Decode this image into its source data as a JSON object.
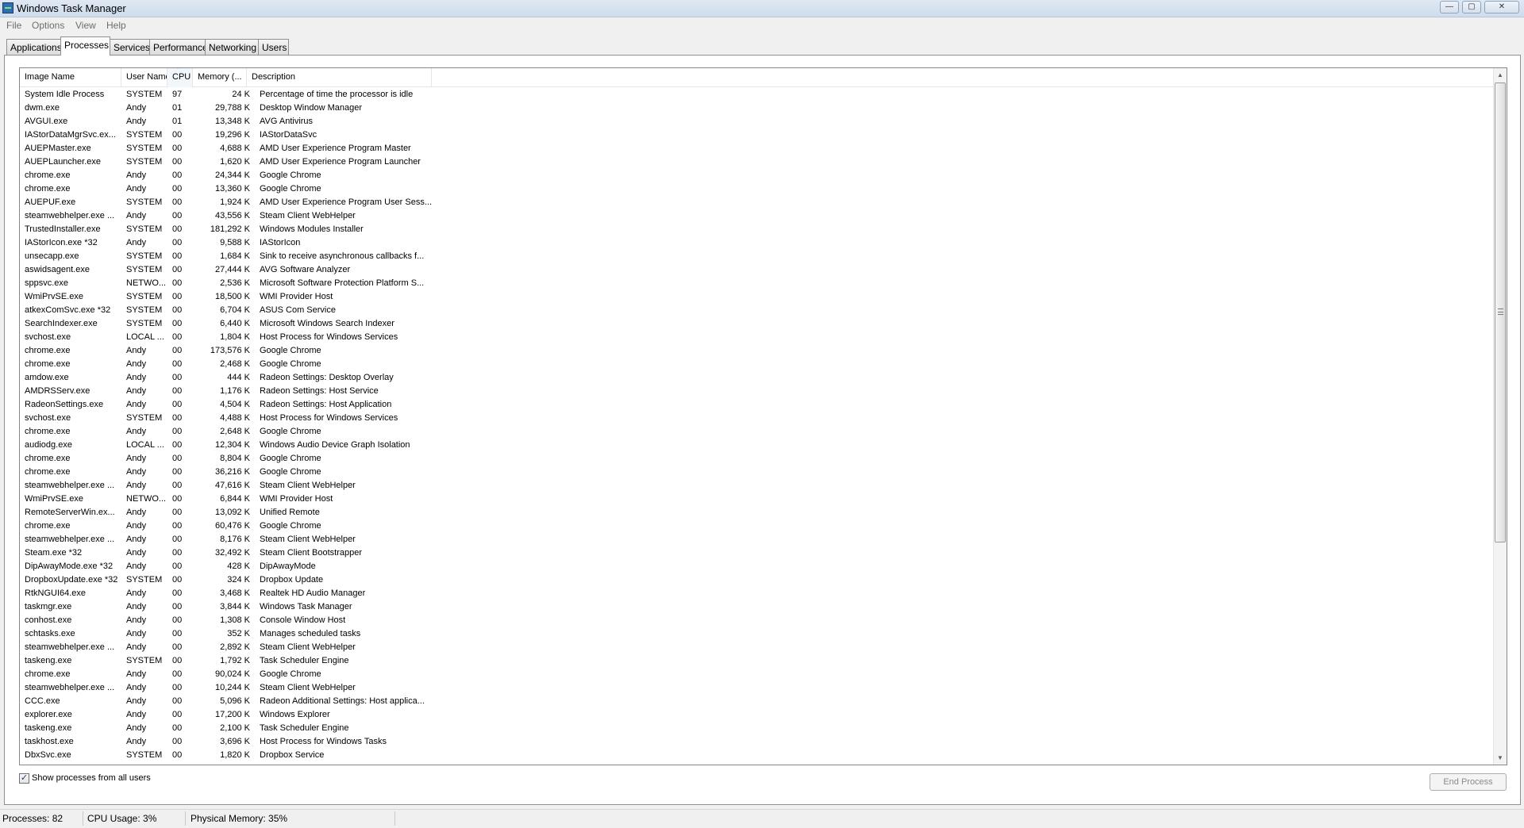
{
  "window": {
    "title": "Windows Task Manager",
    "controls": {
      "minimize": "—",
      "maximize": "▢",
      "close": "✕"
    }
  },
  "menu": [
    "File",
    "Options",
    "View",
    "Help"
  ],
  "tabs": [
    {
      "label": "Applications",
      "active": false
    },
    {
      "label": "Processes",
      "active": true
    },
    {
      "label": "Services",
      "active": false
    },
    {
      "label": "Performance",
      "active": false
    },
    {
      "label": "Networking",
      "active": false
    },
    {
      "label": "Users",
      "active": false
    }
  ],
  "columns": {
    "image_name": "Image Name",
    "user_name": "User Name",
    "cpu": "CPU",
    "memory": "Memory (...",
    "description": "Description",
    "sort_column": "CPU",
    "sort_arrow": "^"
  },
  "processes": [
    [
      "System Idle Process",
      "SYSTEM",
      "97",
      "24 K",
      "Percentage of time the processor is idle"
    ],
    [
      "dwm.exe",
      "Andy",
      "01",
      "29,788 K",
      "Desktop Window Manager"
    ],
    [
      "AVGUI.exe",
      "Andy",
      "01",
      "13,348 K",
      "AVG Antivirus"
    ],
    [
      "IAStorDataMgrSvc.ex...",
      "SYSTEM",
      "00",
      "19,296 K",
      "IAStorDataSvc"
    ],
    [
      "AUEPMaster.exe",
      "SYSTEM",
      "00",
      "4,688 K",
      "AMD User Experience Program Master"
    ],
    [
      "AUEPLauncher.exe",
      "SYSTEM",
      "00",
      "1,620 K",
      "AMD User Experience Program Launcher"
    ],
    [
      "chrome.exe",
      "Andy",
      "00",
      "24,344 K",
      "Google Chrome"
    ],
    [
      "chrome.exe",
      "Andy",
      "00",
      "13,360 K",
      "Google Chrome"
    ],
    [
      "AUEPUF.exe",
      "SYSTEM",
      "00",
      "1,924 K",
      "AMD User Experience Program User Sess..."
    ],
    [
      "steamwebhelper.exe ...",
      "Andy",
      "00",
      "43,556 K",
      "Steam Client WebHelper"
    ],
    [
      "TrustedInstaller.exe",
      "SYSTEM",
      "00",
      "181,292 K",
      "Windows Modules Installer"
    ],
    [
      "IAStorIcon.exe *32",
      "Andy",
      "00",
      "9,588 K",
      "IAStorIcon"
    ],
    [
      "unsecapp.exe",
      "SYSTEM",
      "00",
      "1,684 K",
      "Sink to receive asynchronous callbacks f..."
    ],
    [
      "aswidsagent.exe",
      "SYSTEM",
      "00",
      "27,444 K",
      "AVG Software Analyzer"
    ],
    [
      "sppsvc.exe",
      "NETWO...",
      "00",
      "2,536 K",
      "Microsoft Software Protection Platform S..."
    ],
    [
      "WmiPrvSE.exe",
      "SYSTEM",
      "00",
      "18,500 K",
      "WMI Provider Host"
    ],
    [
      "atkexComSvc.exe *32",
      "SYSTEM",
      "00",
      "6,704 K",
      "ASUS Com Service"
    ],
    [
      "SearchIndexer.exe",
      "SYSTEM",
      "00",
      "6,440 K",
      "Microsoft Windows Search Indexer"
    ],
    [
      "svchost.exe",
      "LOCAL ...",
      "00",
      "1,804 K",
      "Host Process for Windows Services"
    ],
    [
      "chrome.exe",
      "Andy",
      "00",
      "173,576 K",
      "Google Chrome"
    ],
    [
      "chrome.exe",
      "Andy",
      "00",
      "2,468 K",
      "Google Chrome"
    ],
    [
      "amdow.exe",
      "Andy",
      "00",
      "444 K",
      "Radeon Settings: Desktop Overlay"
    ],
    [
      "AMDRSServ.exe",
      "Andy",
      "00",
      "1,176 K",
      "Radeon Settings: Host Service"
    ],
    [
      "RadeonSettings.exe",
      "Andy",
      "00",
      "4,504 K",
      "Radeon Settings: Host Application"
    ],
    [
      "svchost.exe",
      "SYSTEM",
      "00",
      "4,488 K",
      "Host Process for Windows Services"
    ],
    [
      "chrome.exe",
      "Andy",
      "00",
      "2,648 K",
      "Google Chrome"
    ],
    [
      "audiodg.exe",
      "LOCAL ...",
      "00",
      "12,304 K",
      "Windows Audio Device Graph Isolation"
    ],
    [
      "chrome.exe",
      "Andy",
      "00",
      "8,804 K",
      "Google Chrome"
    ],
    [
      "chrome.exe",
      "Andy",
      "00",
      "36,216 K",
      "Google Chrome"
    ],
    [
      "steamwebhelper.exe ...",
      "Andy",
      "00",
      "47,616 K",
      "Steam Client WebHelper"
    ],
    [
      "WmiPrvSE.exe",
      "NETWO...",
      "00",
      "6,844 K",
      "WMI Provider Host"
    ],
    [
      "RemoteServerWin.ex...",
      "Andy",
      "00",
      "13,092 K",
      "Unified Remote"
    ],
    [
      "chrome.exe",
      "Andy",
      "00",
      "60,476 K",
      "Google Chrome"
    ],
    [
      "steamwebhelper.exe ...",
      "Andy",
      "00",
      "8,176 K",
      "Steam Client WebHelper"
    ],
    [
      "Steam.exe *32",
      "Andy",
      "00",
      "32,492 K",
      "Steam Client Bootstrapper"
    ],
    [
      "DipAwayMode.exe *32",
      "Andy",
      "00",
      "428 K",
      "DipAwayMode"
    ],
    [
      "DropboxUpdate.exe *32",
      "SYSTEM",
      "00",
      "324 K",
      "Dropbox Update"
    ],
    [
      "RtkNGUI64.exe",
      "Andy",
      "00",
      "3,468 K",
      "Realtek HD Audio Manager"
    ],
    [
      "taskmgr.exe",
      "Andy",
      "00",
      "3,844 K",
      "Windows Task Manager"
    ],
    [
      "conhost.exe",
      "Andy",
      "00",
      "1,308 K",
      "Console Window Host"
    ],
    [
      "schtasks.exe",
      "Andy",
      "00",
      "352 K",
      "Manages scheduled tasks"
    ],
    [
      "steamwebhelper.exe ...",
      "Andy",
      "00",
      "2,892 K",
      "Steam Client WebHelper"
    ],
    [
      "taskeng.exe",
      "SYSTEM",
      "00",
      "1,792 K",
      "Task Scheduler Engine"
    ],
    [
      "chrome.exe",
      "Andy",
      "00",
      "90,024 K",
      "Google Chrome"
    ],
    [
      "steamwebhelper.exe ...",
      "Andy",
      "00",
      "10,244 K",
      "Steam Client WebHelper"
    ],
    [
      "CCC.exe",
      "Andy",
      "00",
      "5,096 K",
      "Radeon Additional Settings: Host applica..."
    ],
    [
      "explorer.exe",
      "Andy",
      "00",
      "17,200 K",
      "Windows Explorer"
    ],
    [
      "taskeng.exe",
      "Andy",
      "00",
      "2,100 K",
      "Task Scheduler Engine"
    ],
    [
      "taskhost.exe",
      "Andy",
      "00",
      "3,696 K",
      "Host Process for Windows Tasks"
    ],
    [
      "DbxSvc.exe",
      "SYSTEM",
      "00",
      "1,820 K",
      "Dropbox Service"
    ]
  ],
  "scrollbar": {
    "up_arrow": "▲",
    "down_arrow": "▼"
  },
  "show_all": {
    "label": "Show processes from all users",
    "checked": true,
    "check_glyph": "✓"
  },
  "end_process": {
    "label": "End Process",
    "enabled": false
  },
  "status": {
    "processes": "Processes: 82",
    "cpu_usage": "CPU Usage: 3%",
    "physical_memory": "Physical Memory: 35%"
  }
}
